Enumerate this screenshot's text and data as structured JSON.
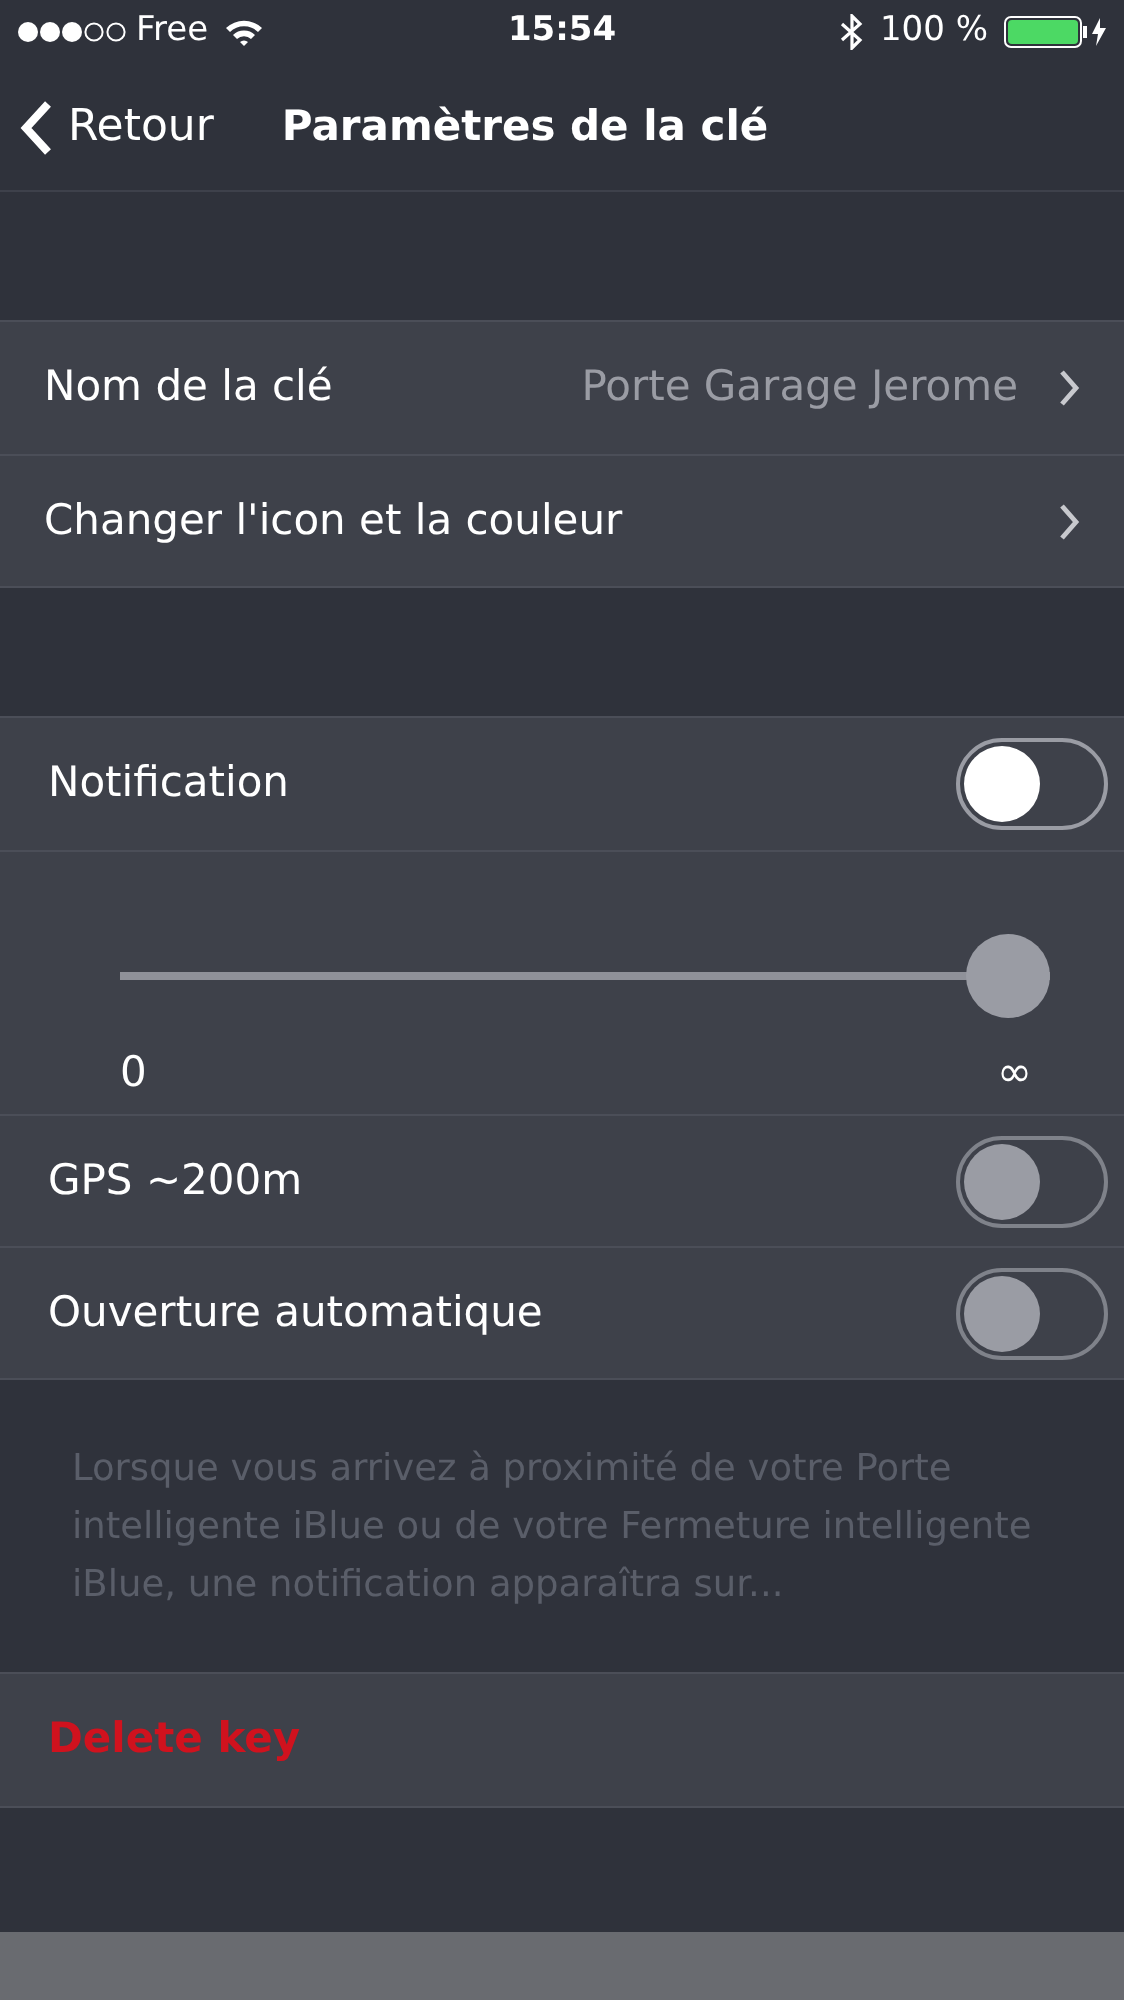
{
  "status_bar": {
    "carrier": "Free",
    "time": "15:54",
    "battery": "100 %"
  },
  "nav": {
    "back": "Retour",
    "title": "Paramètres de la clé"
  },
  "key_rows": [
    {
      "label": "Nom de la clé",
      "value": "Porte Garage Jerome"
    },
    {
      "label": "Changer l'icon et la couleur"
    }
  ],
  "notification": {
    "label": "Notification",
    "on": false,
    "disabled": false
  },
  "slider": {
    "level": 1,
    "min_label": "0",
    "max_label": "∞"
  },
  "options": [
    {
      "label": "GPS ~200m",
      "on": false,
      "disabled": true
    },
    {
      "label": "Ouverture automatique",
      "on": false,
      "disabled": true
    }
  ],
  "description": "Lorsque vous arrivez à proximité de votre Porte intelligente iBlue ou de votre Fermeture intelligente iBlue, une notification apparaîtra sur...",
  "delete": "Delete key"
}
